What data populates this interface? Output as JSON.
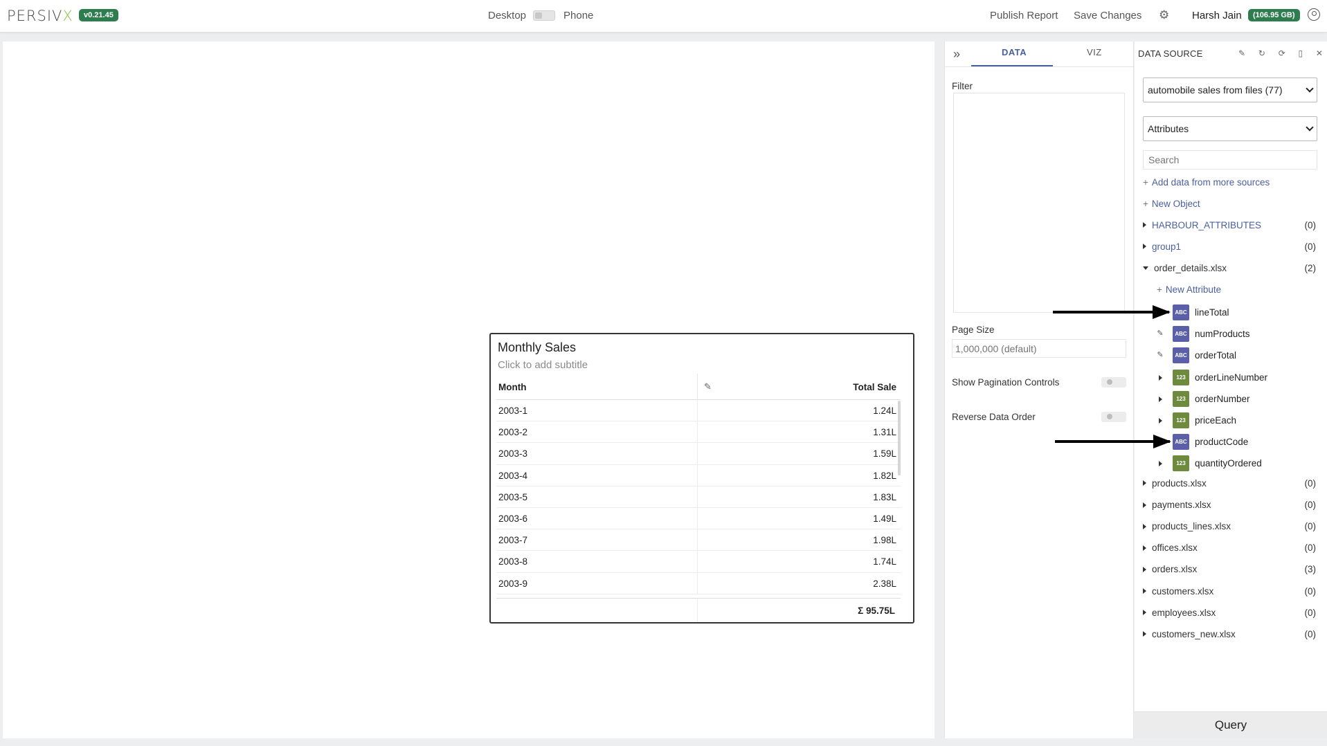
{
  "app": {
    "logo_text": "PERSIV",
    "logo_accent": "X",
    "version": "v0.21.45",
    "accent_color": "#2e7d4f"
  },
  "header": {
    "desktop_label": "Desktop",
    "phone_label": "Phone",
    "publish_label": "Publish Report",
    "save_label": "Save Changes",
    "settings_icon": "gear-icon",
    "user_name": "Harsh Jain",
    "storage_badge": "(106.95 GB)",
    "user_icon": "user-circle-icon"
  },
  "widget": {
    "title": "Monthly Sales",
    "subtitle": "Click to add subtitle",
    "columns": [
      "Month",
      "Total Sale"
    ],
    "rows": [
      {
        "month": "2003-1",
        "total": "1.24L"
      },
      {
        "month": "2003-2",
        "total": "1.31L"
      },
      {
        "month": "2003-3",
        "total": "1.59L"
      },
      {
        "month": "2003-4",
        "total": "1.82L"
      },
      {
        "month": "2003-5",
        "total": "1.83L"
      },
      {
        "month": "2003-6",
        "total": "1.49L"
      },
      {
        "month": "2003-7",
        "total": "1.98L"
      },
      {
        "month": "2003-8",
        "total": "1.74L"
      },
      {
        "month": "2003-9",
        "total": "2.38L"
      }
    ],
    "footer_total": "Σ 95.75L"
  },
  "config": {
    "tabs": [
      "DATA",
      "VIZ"
    ],
    "active_tab": "DATA",
    "filter_label": "Filter",
    "page_size_label": "Page Size",
    "page_size_placeholder": "1,000,000 (default)",
    "show_pagination_label": "Show Pagination Controls",
    "reverse_order_label": "Reverse Data Order"
  },
  "datasource": {
    "title": "DATA SOURCE",
    "selected_source": "automobile sales from files (77)",
    "selected_view": "Attributes",
    "search_placeholder": "Search",
    "add_more_label": "Add data from more sources",
    "new_object_label": "New Object",
    "new_attribute_label": "New Attribute",
    "groups_before": [
      {
        "name": "HARBOUR_ATTRIBUTES",
        "count": "(0)"
      },
      {
        "name": "group1",
        "count": "(0)"
      }
    ],
    "expanded_group": {
      "name": "order_details.xlsx",
      "count": "(2)"
    },
    "attributes": [
      {
        "name": "lineTotal",
        "type": "ABC",
        "ctrl": "none"
      },
      {
        "name": "numProducts",
        "type": "ABC",
        "ctrl": "edit"
      },
      {
        "name": "orderTotal",
        "type": "ABC",
        "ctrl": "edit"
      },
      {
        "name": "orderLineNumber",
        "type": "123",
        "ctrl": "expand"
      },
      {
        "name": "orderNumber",
        "type": "123",
        "ctrl": "expand"
      },
      {
        "name": "priceEach",
        "type": "123",
        "ctrl": "expand"
      },
      {
        "name": "productCode",
        "type": "ABC",
        "ctrl": "none"
      },
      {
        "name": "quantityOrdered",
        "type": "123",
        "ctrl": "expand"
      }
    ],
    "groups_after": [
      {
        "name": "products.xlsx",
        "count": "(0)"
      },
      {
        "name": "payments.xlsx",
        "count": "(0)"
      },
      {
        "name": "products_lines.xlsx",
        "count": "(0)"
      },
      {
        "name": "offices.xlsx",
        "count": "(0)"
      },
      {
        "name": "orders.xlsx",
        "count": "(3)"
      },
      {
        "name": "customers.xlsx",
        "count": "(0)"
      },
      {
        "name": "employees.xlsx",
        "count": "(0)"
      },
      {
        "name": "customers_new.xlsx",
        "count": "(0)"
      }
    ],
    "query_label": "Query"
  }
}
